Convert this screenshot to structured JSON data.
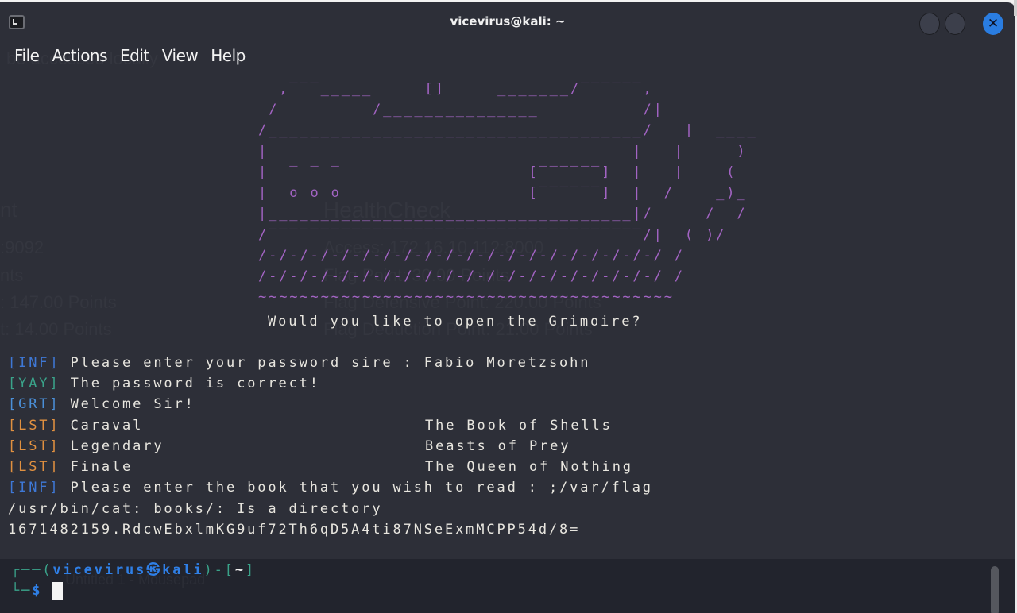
{
  "window": {
    "title": "vicevirus@kali: ~",
    "icon": "terminal-icon",
    "controls": {
      "minimize": "",
      "maximize": "",
      "close": "✕"
    }
  },
  "menu": [
    "File",
    "Actions",
    "Edit",
    "View",
    "Help"
  ],
  "background_ghost_text": {
    "menu_overlap": "be accessed locally",
    "left_column": [
      "nt",
      ":9092",
      "nts",
      ": 147.00 Points",
      "t: 14.00 Points"
    ],
    "center_column": [
      "HealthCheck",
      "Access: 172.16.10.112:8000",
      "Flag Point: 30.00 Points",
      "Flag Defensive Point: 220.00 Points",
      "Flag Deduction Point: 21.00 Points"
    ],
    "bottom": "Untitled 1 - Mousepad"
  },
  "ascii_art": [
    "  ,‾‾‾_____     []     _______/‾‾‾‾‾‾,",
    " /         /_______________          /|",
    "/____________________________________/   |  ____",
    "|                                   |   |     )",
    "|  ‾ ‾ ‾                  [‾‾‾‾‾‾]  |   |    (",
    "|  o o o                  [‾‾‾‾‾‾]  |  /    _)_",
    "|___________________________________|/     /  /",
    "/‾‾‾‾‾‾‾‾‾‾‾‾‾‾‾‾‾‾‾‾‾‾‾‾‾‾‾‾‾‾‾‾‾‾‾‾/|  ( )/",
    "/-/-/-/-/-/-/-/-/-/-/-/-/-/-/-/-/-/-/-/ /",
    "/-/-/-/-/-/-/-/-/-/-/-/-/-/-/-/-/-/-/-/ /",
    "~~~~~~~~~~~~~~~~~~~~~~~~~~~~~~~~~~~~~~~~"
  ],
  "question": "Would you like to open the Grimoire?",
  "output": [
    {
      "tag": "[INF]",
      "type": "inf",
      "text": " Please enter your password sire : Fabio Moretzsohn"
    },
    {
      "tag": "[YAY]",
      "type": "yay",
      "text": " The password is correct!"
    },
    {
      "tag": "[GRT]",
      "type": "grt",
      "text": " Welcome Sir!"
    },
    {
      "tag": "[LST]",
      "type": "lst",
      "text": " Caraval",
      "col2": "The Book of Shells"
    },
    {
      "tag": "[LST]",
      "type": "lst",
      "text": " Legendary",
      "col2": "Beasts of Prey"
    },
    {
      "tag": "[LST]",
      "type": "lst",
      "text": " Finale",
      "col2": "The Queen of Nothing"
    },
    {
      "tag": "[INF]",
      "type": "inf",
      "text": " Please enter the book that you wish to read : ;/var/flag"
    },
    {
      "tag": "",
      "type": "plain",
      "text": "/usr/bin/cat: books/: Is a directory"
    },
    {
      "tag": "",
      "type": "plain",
      "text": "1671482159.RdcwEbxlmKG9uf72Th6qD5A4ti87NSeExmMCPP54d/8="
    }
  ],
  "prompt": {
    "corner_top": "┌──(",
    "user": "vicevirus",
    "at_symbol": "㉿",
    "host": "kali",
    "close_paren": ")-[",
    "cwd": "~",
    "close_bracket": "]",
    "corner_bottom": "└─",
    "dollar": "$"
  }
}
